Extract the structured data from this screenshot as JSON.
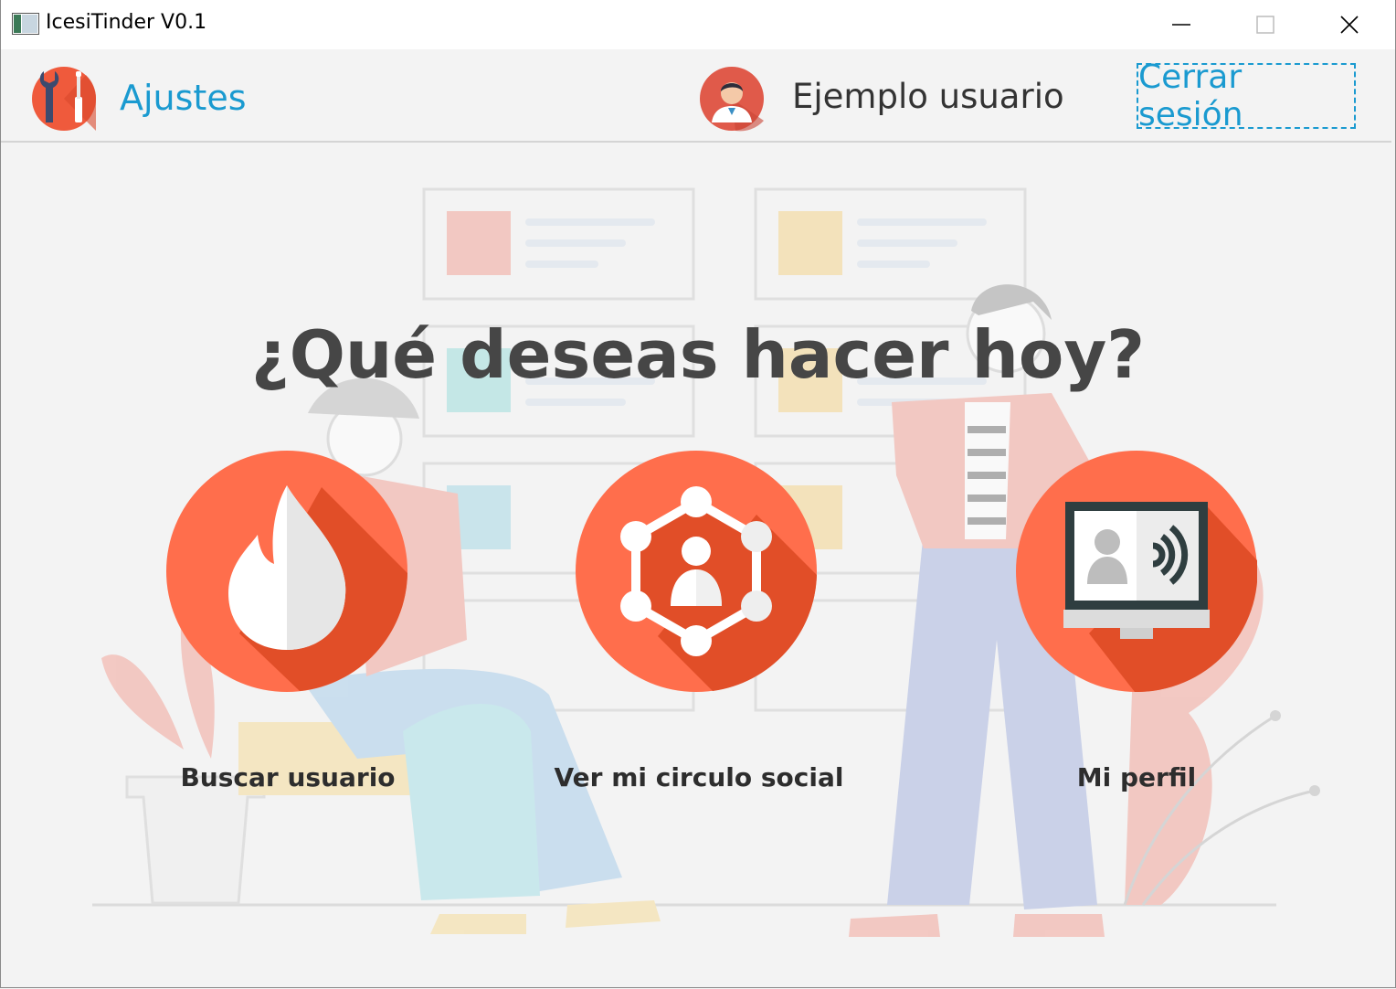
{
  "window": {
    "title": "IcesiTinder V0.1"
  },
  "header": {
    "settings_label": "Ajustes",
    "user_name": "Ejemplo usuario",
    "logout_label": "Cerrar sesión"
  },
  "main": {
    "headline": "¿Qué deseas hacer hoy?",
    "actions": [
      {
        "label": "Buscar usuario",
        "icon": "flame-icon"
      },
      {
        "label": "Ver mi circulo social",
        "icon": "social-network-icon"
      },
      {
        "label": "Mi perfil",
        "icon": "profile-monitor-icon"
      }
    ]
  },
  "colors": {
    "accent": "#1a9ad0",
    "action_circle": "#ff6e4c",
    "action_shadow": "#e14e28",
    "headline": "#464646"
  }
}
